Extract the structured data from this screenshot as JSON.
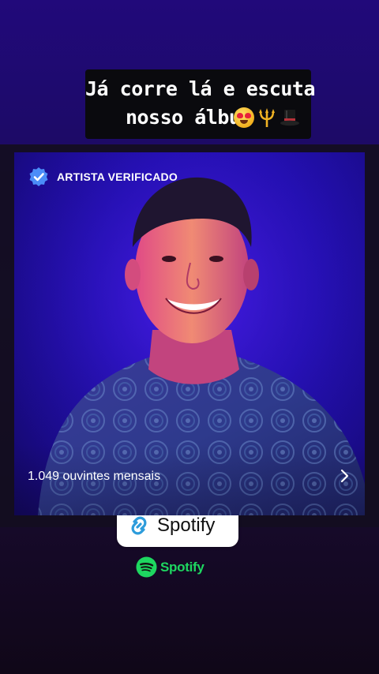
{
  "story": {
    "caption_line1": "Já corre lá e escuta",
    "caption_line2": "nosso álbum",
    "caption_emojis": [
      "smiling-face-with-heart-eyes-icon",
      "trident-icon",
      "top-hat-icon"
    ]
  },
  "artist_card": {
    "verified_label": "ARTISTA VERIFICADO",
    "monthly_listeners": "1.049 ouvintes mensais",
    "accent": "#2a12c4"
  },
  "link_sticker": {
    "label": "Spotify",
    "link_color": "#2d9cdb"
  },
  "brand": {
    "wordmark": "Spotify",
    "color": "#1ed760"
  }
}
